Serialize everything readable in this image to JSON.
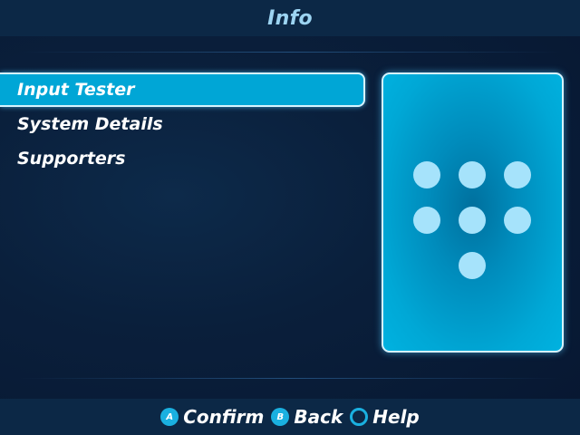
{
  "header": {
    "title": "Info"
  },
  "menu": {
    "items": [
      {
        "label": "Input Tester",
        "selected": true
      },
      {
        "label": "System Details",
        "selected": false
      },
      {
        "label": "Supporters",
        "selected": false
      }
    ]
  },
  "preview": {
    "icon": "dot-grid-icon"
  },
  "footer": {
    "hints": [
      {
        "button": "A",
        "label": "Confirm",
        "icon": "a-button-icon"
      },
      {
        "button": "B",
        "label": "Back",
        "icon": "b-button-icon"
      },
      {
        "button": "",
        "label": "Help",
        "icon": "ring-button-icon"
      }
    ]
  },
  "colors": {
    "accent": "#00a6d6",
    "background": "#0a1f3b",
    "bar": "#0c2846",
    "title": "#9cd4f2",
    "dot": "#a6e3fb"
  }
}
